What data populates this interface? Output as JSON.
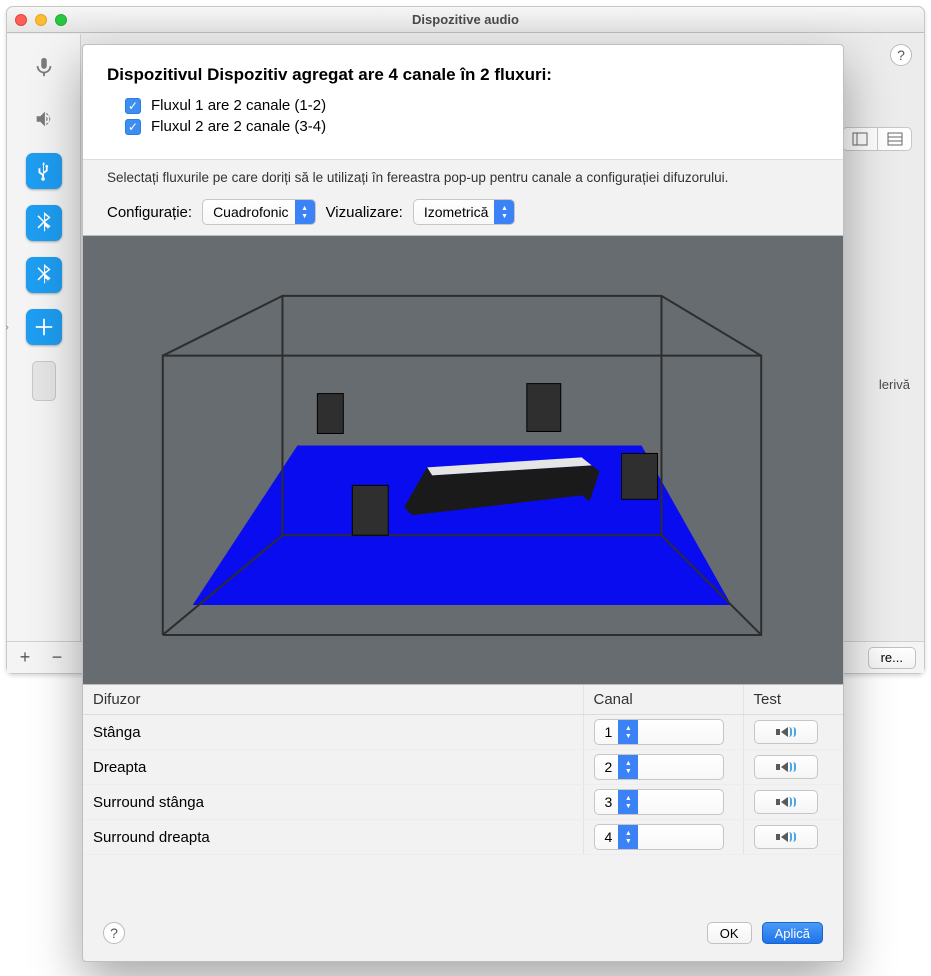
{
  "window": {
    "title": "Dispozitive audio",
    "footer": {
      "configure_label": "re..."
    },
    "body_right_text": "lerivă"
  },
  "sheet": {
    "heading": "Dispozitivul Dispozitiv agregat are 4 canale în 2 fluxuri:",
    "streams": [
      {
        "checked": true,
        "label": "Fluxul 1 are 2 canale (1-2)"
      },
      {
        "checked": true,
        "label": "Fluxul 2 are 2 canale (3-4)"
      }
    ],
    "hint": "Selectați fluxurile pe care doriți să le utilizați în fereastra pop-up pentru canale a configurației difuzorului.",
    "config_label": "Configurație:",
    "config_value": "Cuadrofonic",
    "view_label": "Vizualizare:",
    "view_value": "Izometrică",
    "table": {
      "headers": {
        "speaker": "Difuzor",
        "channel": "Canal",
        "test": "Test"
      },
      "rows": [
        {
          "name": "Stânga",
          "channel": "1"
        },
        {
          "name": "Dreapta",
          "channel": "2"
        },
        {
          "name": "Surround stânga",
          "channel": "3"
        },
        {
          "name": "Surround dreapta",
          "channel": "4"
        }
      ]
    },
    "buttons": {
      "ok": "OK",
      "apply": "Aplică"
    }
  },
  "icons": {
    "help": "?",
    "plus": "+",
    "minus": "−",
    "gear": "⚙",
    "check": "✓",
    "chev_up": "▲",
    "chev_down": "▼",
    "expand": "›"
  }
}
